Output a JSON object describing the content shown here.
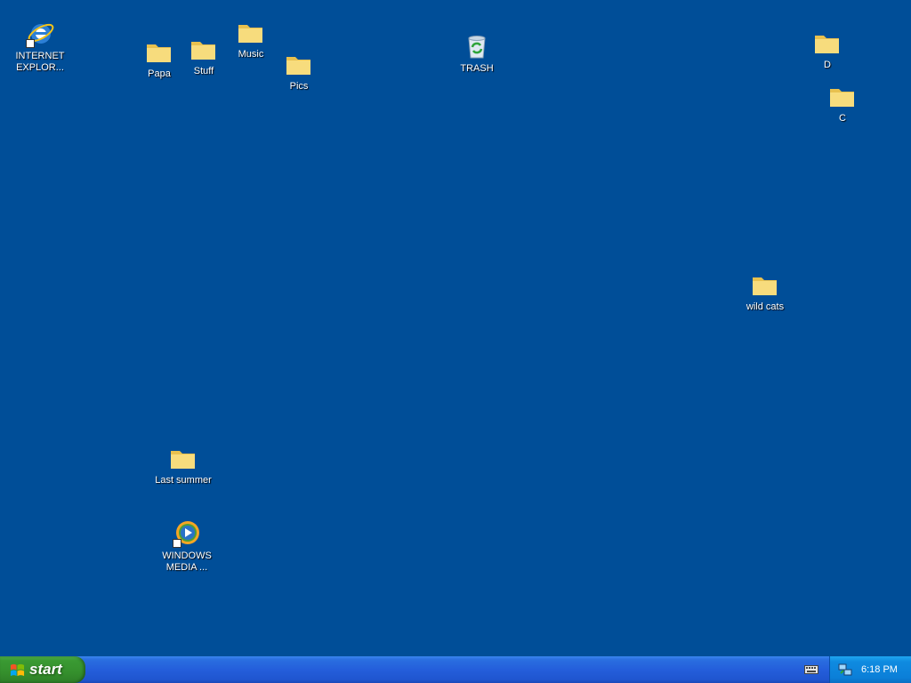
{
  "desktop": {
    "background_color": "#004e98",
    "icons": [
      {
        "name": "internet-explorer-shortcut",
        "label": "INTERNET\nEXPLOR...",
        "type": "ie"
      },
      {
        "name": "folder-papa",
        "label": "Papa",
        "type": "folder"
      },
      {
        "name": "folder-stuff",
        "label": "Stuff",
        "type": "folder"
      },
      {
        "name": "folder-music",
        "label": "Music",
        "type": "folder"
      },
      {
        "name": "folder-pics",
        "label": "Pics",
        "type": "folder"
      },
      {
        "name": "trash",
        "label": "TRASH",
        "type": "recycle-bin"
      },
      {
        "name": "folder-d",
        "label": "D",
        "type": "folder"
      },
      {
        "name": "folder-c",
        "label": "C",
        "type": "folder"
      },
      {
        "name": "folder-wild-cats",
        "label": "wild cats",
        "type": "folder"
      },
      {
        "name": "folder-last-summer",
        "label": "Last summer",
        "type": "folder"
      },
      {
        "name": "windows-media-shortcut",
        "label": "WINDOWS\nMEDIA ...",
        "type": "wmp"
      }
    ]
  },
  "taskbar": {
    "start_label": "start",
    "clock": "6:18 PM",
    "tray_icons": [
      "keyboard-icon",
      "network-icon"
    ]
  },
  "colors": {
    "folder": "#f5d76e",
    "taskbar": "#245edb",
    "start": "#35902d",
    "tray": "#0b7fd8"
  }
}
